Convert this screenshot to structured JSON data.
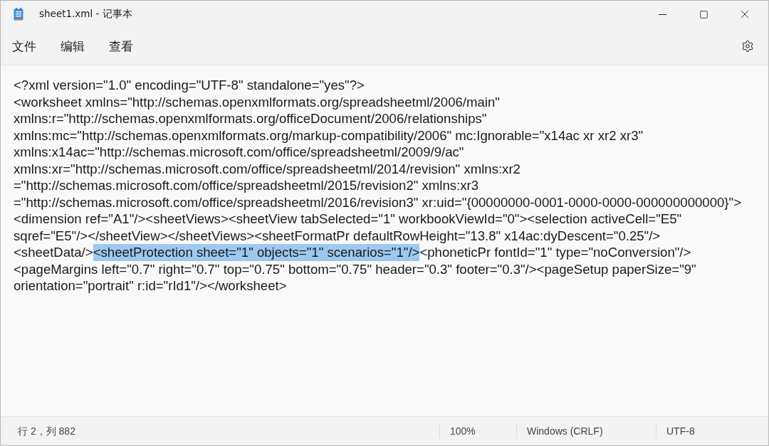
{
  "window": {
    "title": "sheet1.xml - 记事本"
  },
  "menu": [
    {
      "label": "文件"
    },
    {
      "label": "编辑"
    },
    {
      "label": "查看"
    }
  ],
  "editor": {
    "lines": [
      {
        "parts": [
          {
            "text": "<?xml version=\"1.0\" encoding=\"UTF-8\" standalone=\"yes\"?>",
            "selected": false
          }
        ]
      },
      {
        "parts": [
          {
            "text": "<worksheet xmlns=\"http://schemas.openxmlformats.org/spreadsheetml/2006/main\"",
            "selected": false
          }
        ]
      },
      {
        "parts": [
          {
            "text": "xmlns:r=\"http://schemas.openxmlformats.org/officeDocument/2006/relationships\"",
            "selected": false
          }
        ]
      },
      {
        "parts": [
          {
            "text": "xmlns:mc=\"http://schemas.openxmlformats.org/markup-compatibility/2006\" mc:Ignorable=\"x14ac xr xr2 xr3\"",
            "selected": false
          }
        ]
      },
      {
        "parts": [
          {
            "text": "xmlns:x14ac=\"http://schemas.microsoft.com/office/spreadsheetml/2009/9/ac\"",
            "selected": false
          }
        ]
      },
      {
        "parts": [
          {
            "text": "xmlns:xr=\"http://schemas.microsoft.com/office/spreadsheetml/2014/revision\" xmlns:xr2",
            "selected": false
          }
        ]
      },
      {
        "parts": [
          {
            "text": "=\"http://schemas.microsoft.com/office/spreadsheetml/2015/revision2\" xmlns:xr3",
            "selected": false
          }
        ]
      },
      {
        "parts": [
          {
            "text": "=\"http://schemas.microsoft.com/office/spreadsheetml/2016/revision3\" xr:uid=\"{00000000-0001-0000-0000-000000000000}\">",
            "selected": false
          }
        ]
      },
      {
        "parts": [
          {
            "text": "<dimension ref=\"A1\"/><sheetViews><sheetView tabSelected=\"1\" workbookViewId=\"0\"><selection activeCell=\"E5\"",
            "selected": false
          }
        ]
      },
      {
        "parts": [
          {
            "text": "sqref=\"E5\"/></sheetView></sheetViews><sheetFormatPr defaultRowHeight=\"13.8\" x14ac:dyDescent=\"0.25\"/>",
            "selected": false
          }
        ]
      },
      {
        "parts": [
          {
            "text": "<sheetData/>",
            "selected": false
          },
          {
            "text": "<sheetProtection sheet=\"1\" objects=\"1\" scenarios=\"1\"/>",
            "selected": true
          },
          {
            "text": "<phoneticPr fontId=\"1\" type=\"noConversion\"/>",
            "selected": false
          }
        ]
      },
      {
        "parts": [
          {
            "text": "<pageMargins left=\"0.7\" right=\"0.7\" top=\"0.75\" bottom=\"0.75\" header=\"0.3\" footer=\"0.3\"/><pageSetup paperSize=\"9\"",
            "selected": false
          }
        ]
      },
      {
        "parts": [
          {
            "text": "orientation=\"portrait\" r:id=\"rId1\"/></worksheet>",
            "selected": false
          }
        ]
      }
    ]
  },
  "status_bar": {
    "position": "行 2，列 882",
    "zoom": "100%",
    "line_ending": "Windows (CRLF)",
    "encoding": "UTF-8"
  }
}
